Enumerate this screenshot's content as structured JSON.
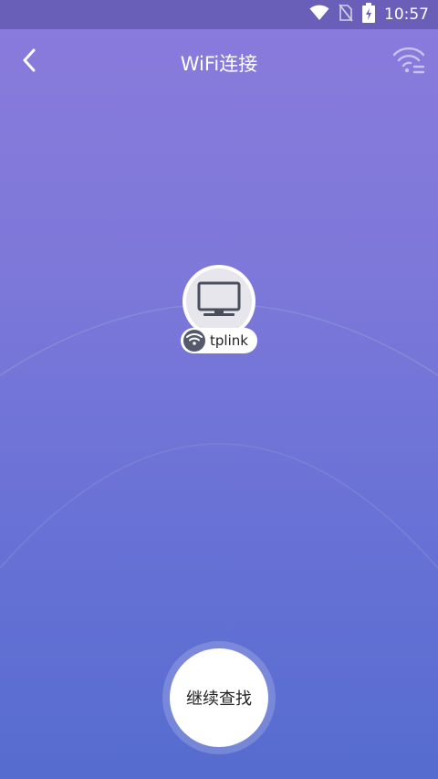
{
  "status_bar": {
    "time": "10:57",
    "icons": [
      "wifi-signal-icon",
      "no-sim-icon",
      "battery-charging-icon"
    ]
  },
  "header": {
    "title": "WiFi连接",
    "back_icon": "back-arrow-icon",
    "action_icon": "wifi-list-icon"
  },
  "device": {
    "icon": "monitor-icon",
    "name": "tplink",
    "badge_icon": "wifi-icon"
  },
  "actions": {
    "continue_label": "继续查找"
  },
  "colors": {
    "status_bar": "#6a5fb8",
    "gradient_top": "#8a7bdc",
    "gradient_bottom": "#566ccf",
    "radar_line": "#8a8fd6",
    "badge": "#555a6b"
  }
}
